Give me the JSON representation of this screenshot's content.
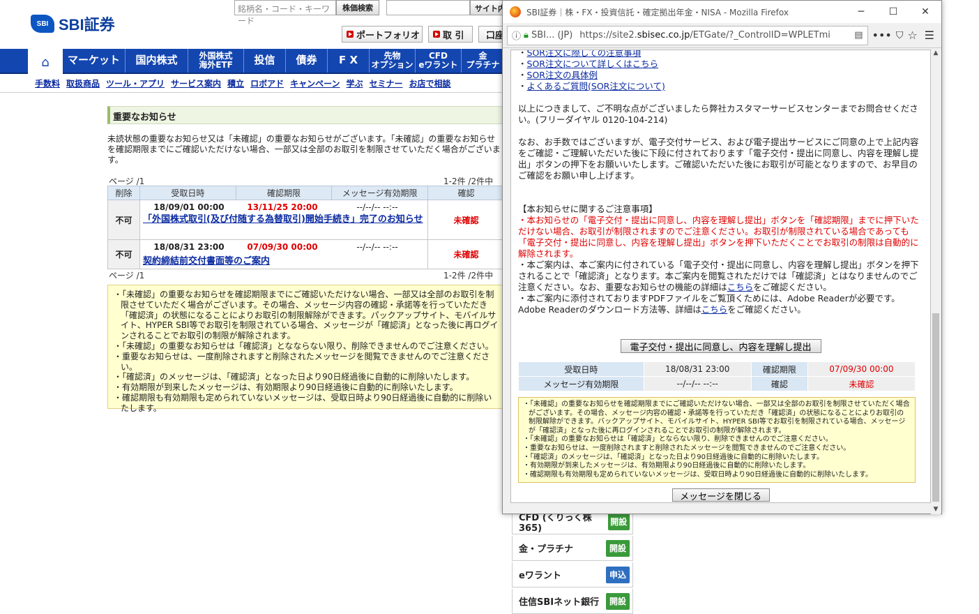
{
  "site": {
    "logo_mark": "SBI",
    "logo_name": "SBI証券",
    "search_placeholder": "銘柄名・コード・キーワード",
    "search_button": "株価検索",
    "site_search_button": "サイト内検索",
    "header_buttons": [
      "ポートフォリオ",
      "取 引",
      "口座管理"
    ],
    "nav": [
      "マーケット",
      "国内株式",
      "外国株式\n海外ETF",
      "投信",
      "債券",
      "F X",
      "先物\nオプション",
      "CFD\neワラント",
      "金\nプラチナ"
    ],
    "subnav": [
      "手数料",
      "取扱商品",
      "ツール・アプリ",
      "サービス案内",
      "積立",
      "ロボアド",
      "キャンペーン",
      "学ぶ",
      "セミナー",
      "お店で相談"
    ]
  },
  "notices": {
    "title": "重要なお知らせ",
    "intro": "未読状態の重要なお知らせ又は「未確認」の重要なお知らせがございます。「未確認」の重要なお知らせを確認期限までにご確認いただけない場合、一部又は全部のお取引を制限させていただく場合がございます。",
    "page_label": "ページ /1",
    "count_label": "1-2件 /2件中",
    "columns": [
      "削除",
      "受取日時",
      "確認期限",
      "メッセージ有効期限",
      "確認"
    ],
    "rows": [
      {
        "delete": "不可",
        "received": "18/09/01 00:00",
        "deadline": "13/11/25 20:00",
        "expiry": "--/--/-- --:--",
        "title": "「外国株式取引(及び付随する為替取引)開始手続き」完了のお知らせ",
        "status": "未確認"
      },
      {
        "delete": "不可",
        "received": "18/08/31 23:00",
        "deadline": "07/09/30 00:00",
        "expiry": "--/--/-- --:--",
        "title": "契約締結前交付書面等のご案内",
        "status": "未確認"
      }
    ],
    "notes": [
      "・「未確認」の重要なお知らせを確認期限までにご確認いただけない場合、一部又は全部のお取引を制限させていただく場合がございます。その場合、メッセージ内容の確認・承諾等を行っていただき「確認済」の状態になることによりお取引の制限解除ができます。パックアップサイト、モバイルサイト、HYPER SBI等でお取引を制限されている場合、メッセージが「確認済」となった後に再ログインされることでお取引の制限が解除されます。",
      "・「未確認」の重要なお知らせは「確認済」となならない限り、削除できませんのでご注意ください。",
      "・重要なお知らせは、一度削除されますと削除されたメッセージを閲覧できませんのでご注意ください。",
      "・「確認済」のメッセージは、「確認済」となった日より90日経過後に自動的に削除いたします。",
      "・有効期限が到来したメッセージは、有効期限より90日経過後に自動的に削除いたします。",
      "・確認期限も有効期限も定められていないメッセージは、受取日時より90日経過後に自動的に削除いたします。"
    ]
  },
  "services": [
    {
      "label": "CFD (くりっく株365)",
      "button": "開設",
      "color": "#3a9a3a"
    },
    {
      "label": "金・プラチナ",
      "button": "開設",
      "color": "#3a9a3a"
    },
    {
      "label": "eワラント",
      "button": "申込",
      "color": "#2f6fc0"
    },
    {
      "label": "住信SBIネット銀行",
      "button": "開設",
      "color": "#3a9a3a"
    }
  ],
  "popup": {
    "window_title": "SBI証券｜株・FX・投資信託・確定拠出年金・NISA - Mozilla Firefox",
    "win_controls": [
      "─",
      "☐",
      "✕"
    ],
    "url_identity": "SBI... (JP)",
    "url_prefix": "https://site2.",
    "url_domain": "sbisec.co.jp",
    "url_path": "/ETGate/?_ControlID=WPLETmi",
    "links": [
      "SOR注文に際しての注意事項",
      "SOR注文について詳しくはこちら",
      "SOR注文の具体例",
      "よくあるご質問(SOR注文について)"
    ],
    "para1": "以上につきまして、ご不明な点がございましたら弊社カスタマーサービスセンターまでお問合せください。(フリーダイヤル 0120-104-214)",
    "para2": "なお、お手数ではございますが、電子交付サービス、および電子提出サービスにご同意の上で上記内容をご確認・ご理解いただいた後に下段に付されております「電子交付・提出に同意し、内容を理解し提出」ボタンの押下をお願いいたします。ご確認いただいた後にお取引が可能となりますので、お早目のご確認をお願い申し上げます。",
    "caution_title": "【本お知らせに関するご注意事項】",
    "caution_red": "・本お知らせの「電子交付・提出に同意し、内容を理解し提出」ボタンを「確認期限」までに押下いただけない場合、お取引が制限されますのでご注意ください。お取引が制限されている場合であっても「電子交付・提出に同意し、内容を理解し提出」ボタンを押下いただくことでお取引の制限は自動的に解除されます。",
    "caution2a": "・本ご案内は、本ご案内に付されている「電子交付・提出に同意し、内容を理解し提出」ボタンを押下されることで「確認済」となります。本ご案内を閲覧されただけでは「確認済」とはなりませんのでご注意ください。なお、重要なお知らせの機能の詳細は",
    "link_here": "こちら",
    "caution2b": "をご確認ください。",
    "caution3a": "・本ご案内に添付されておりますPDFファイルをご覧頂くためには、Adobe Readerが必要です。Adobe Readerのダウンロード方法等、詳細は",
    "caution3b": "をご確認ください。",
    "submit_button": "電子交付・提出に同意し、内容を理解し提出",
    "meta": {
      "received_label": "受取日時",
      "received": "18/08/31 23:00",
      "deadline_label": "確認期限",
      "deadline": "07/09/30 00:00",
      "expiry_label": "メッセージ有効期限",
      "expiry": "--/--/-- --:--",
      "status_label": "確認",
      "status": "未確認"
    },
    "notes": [
      "・「未確認」の重要なお知らせを確認期限までにご確認いただけない場合、一部又は全部のお取引を制限させていただく場合がございます。その場合、メッセージ内容の確認・承諾等を行っていただき「確認済」の状態になることによりお取引の制限解除ができます。バックアップサイト、モバイルサイト、HYPER SBI等でお取引を制限されている場合、メッセージが「確認済」となった後に再ログインされることでお取引の制限が解除されます。",
      "・「未確認」の重要なお知らせは「確認済」とならない限り、削除できませんのでご注意ください。",
      "・重要なお知らせは、一度削除されますと削除されたメッセージを閲覧できませんのでご注意ください。",
      "・「確認済」のメッセージは、「確認済」となった日より90日経過後に自動的に削除いたします。",
      "・有効期限が到来したメッセージは、有効期限より90日経過後に自動的に削除いたします。",
      "・確認期限も有効期限も定められていないメッセージは、受取日時より90日経過後に自動的に削除いたします。"
    ],
    "close_button": "メッセージを閉じる"
  }
}
